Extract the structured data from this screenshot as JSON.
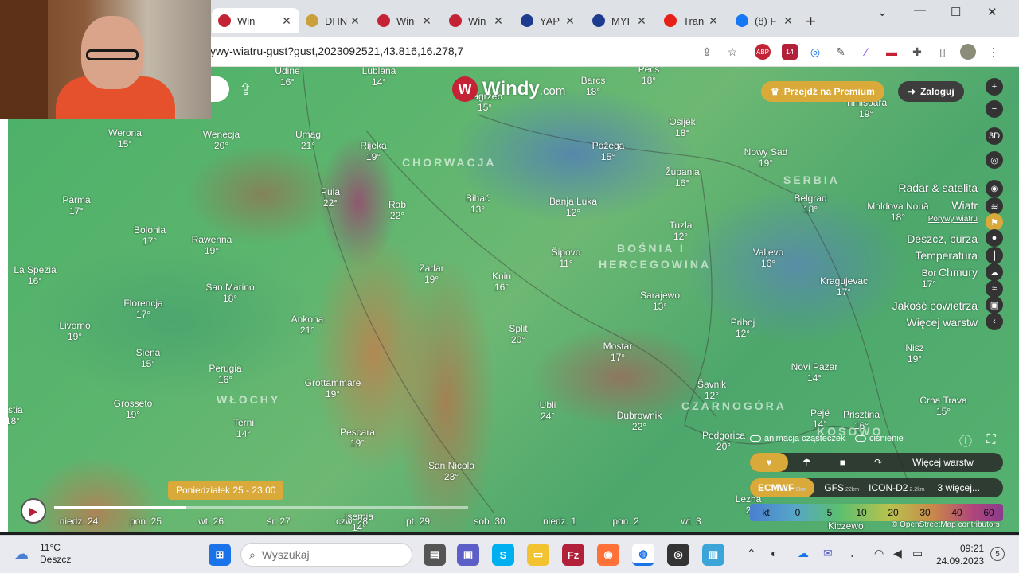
{
  "browser": {
    "tabs": [
      {
        "title": "Win",
        "color": "#c32335",
        "active": true
      },
      {
        "title": "DHN",
        "color": "#c9a03c"
      },
      {
        "title": "Win",
        "color": "#c32335"
      },
      {
        "title": "Win",
        "color": "#c32335"
      },
      {
        "title": "YAP",
        "color": "#1d3c8f"
      },
      {
        "title": "MYI",
        "color": "#1d3c8f"
      },
      {
        "title": "Tran",
        "color": "#e62117"
      },
      {
        "title": "(8) F",
        "color": "#1877f2"
      }
    ],
    "new_tab": "+",
    "url": "ywy-wiatru-gust?gust,2023092521,43.816,16.278,7",
    "extension_badge": "14"
  },
  "map": {
    "logo_text": "Windy",
    "logo_suffix": ".com",
    "premium_label": "Przejdź na Premium",
    "login_label": "Zaloguj",
    "countries": [
      "CHORWACJA",
      "SERBIA",
      "BOŚNIA I",
      "HERCEGOWINA",
      "WŁOCHY",
      "CZARNOGÓRA",
      "KOSOWO"
    ],
    "cities": [
      {
        "name": "Udine",
        "temp": "16°"
      },
      {
        "name": "Lublana",
        "temp": "14°"
      },
      {
        "name": "Zagrzeb",
        "temp": "15°"
      },
      {
        "name": "Barcs",
        "temp": "18°"
      },
      {
        "name": "Pécs",
        "temp": "18°"
      },
      {
        "name": "Timișoara",
        "temp": "19°"
      },
      {
        "name": "Werona",
        "temp": "15°"
      },
      {
        "name": "Wenecja",
        "temp": "20°"
      },
      {
        "name": "Umag",
        "temp": "21°"
      },
      {
        "name": "Rijeka",
        "temp": "19°"
      },
      {
        "name": "Osijek",
        "temp": "18°"
      },
      {
        "name": "Požega",
        "temp": "15°"
      },
      {
        "name": "Nowy Sad",
        "temp": "19°"
      },
      {
        "name": "Županja",
        "temp": "16°"
      },
      {
        "name": "Parma",
        "temp": "17°"
      },
      {
        "name": "Pula",
        "temp": "22°"
      },
      {
        "name": "Rab",
        "temp": "22°"
      },
      {
        "name": "Bihać",
        "temp": "13°"
      },
      {
        "name": "Banja Luka",
        "temp": "12°"
      },
      {
        "name": "Belgrad",
        "temp": "18°"
      },
      {
        "name": "Moldova Nouă",
        "temp": "18°"
      },
      {
        "name": "Bolonia",
        "temp": "17°"
      },
      {
        "name": "Rawenna",
        "temp": "19°"
      },
      {
        "name": "Tuzla",
        "temp": "12°"
      },
      {
        "name": "La Spezia",
        "temp": "16°"
      },
      {
        "name": "Zadar",
        "temp": "19°"
      },
      {
        "name": "Šipovo",
        "temp": "11°"
      },
      {
        "name": "Valjevo",
        "temp": "16°"
      },
      {
        "name": "Knin",
        "temp": "16°"
      },
      {
        "name": "San Marino",
        "temp": "18°"
      },
      {
        "name": "Kragujevac",
        "temp": "17°"
      },
      {
        "name": "Bor",
        "temp": "17°"
      },
      {
        "name": "Florencja",
        "temp": "17°"
      },
      {
        "name": "Sarajewo",
        "temp": "13°"
      },
      {
        "name": "Ankona",
        "temp": "21°"
      },
      {
        "name": "Livorno",
        "temp": "19°"
      },
      {
        "name": "Split",
        "temp": "20°"
      },
      {
        "name": "Priboj",
        "temp": "12°"
      },
      {
        "name": "Mostar",
        "temp": "17°"
      },
      {
        "name": "Siena",
        "temp": "15°"
      },
      {
        "name": "Nisz",
        "temp": "19°"
      },
      {
        "name": "Perugia",
        "temp": "16°"
      },
      {
        "name": "Grottammare",
        "temp": "19°"
      },
      {
        "name": "Novi Pazar",
        "temp": "14°"
      },
      {
        "name": "Šavnik",
        "temp": "12°"
      },
      {
        "name": "Grosseto",
        "temp": "19°"
      },
      {
        "name": "Ubli",
        "temp": "24°"
      },
      {
        "name": "Dubrownik",
        "temp": "22°"
      },
      {
        "name": "Pejë",
        "temp": "14°"
      },
      {
        "name": "Prisztina",
        "temp": "16°"
      },
      {
        "name": "Crna Trava",
        "temp": "15°"
      },
      {
        "name": "astia",
        "temp": "18°"
      },
      {
        "name": "Terni",
        "temp": "14°"
      },
      {
        "name": "Pescara",
        "temp": "19°"
      },
      {
        "name": "Podgorica",
        "temp": "20°"
      },
      {
        "name": "San Nicola",
        "temp": "23°"
      },
      {
        "name": "Lezha",
        "temp": "2"
      },
      {
        "name": "Isernia",
        "temp": "14°"
      },
      {
        "name": "Kiczewo",
        "temp": ""
      }
    ],
    "layers": [
      "Radar & satelita",
      "Wiatr",
      "Porywy wiatru",
      "Deszcz, burza",
      "Temperatura",
      "Chmury",
      "Jakość powietrza",
      "Więcej warstw"
    ],
    "right_buttons": [
      "+",
      "−",
      "3D"
    ],
    "toggles": {
      "particles": "animacja cząsteczek",
      "pressure": "ciśnienie"
    },
    "layer_bar_more": "Więcej warstw",
    "models": [
      {
        "name": "ECMWF",
        "res": "9km",
        "active": true
      },
      {
        "name": "GFS",
        "res": "22km"
      },
      {
        "name": "ICON-D2",
        "res": "2.2km"
      },
      {
        "name": "3 więcej...",
        "res": ""
      }
    ],
    "scale": {
      "unit": "kt",
      "ticks": [
        "0",
        "5",
        "10",
        "20",
        "30",
        "40",
        "60"
      ]
    },
    "attribution": "© OpenStreetMap contributors",
    "timeline": {
      "current": "Poniedziałek 25 - 23:00",
      "progress": 0.32,
      "days": [
        "niedz. 24",
        "pon. 25",
        "wt. 26",
        "śr. 27",
        "czw. 28",
        "pt. 29",
        "sob. 30",
        "niedz. 1",
        "pon. 2",
        "wt. 3"
      ]
    }
  },
  "taskbar": {
    "weather_temp": "11°C",
    "weather_desc": "Deszcz",
    "search_placeholder": "Wyszukaj",
    "time": "09:21",
    "date": "24.09.2023",
    "notifications": "5"
  }
}
